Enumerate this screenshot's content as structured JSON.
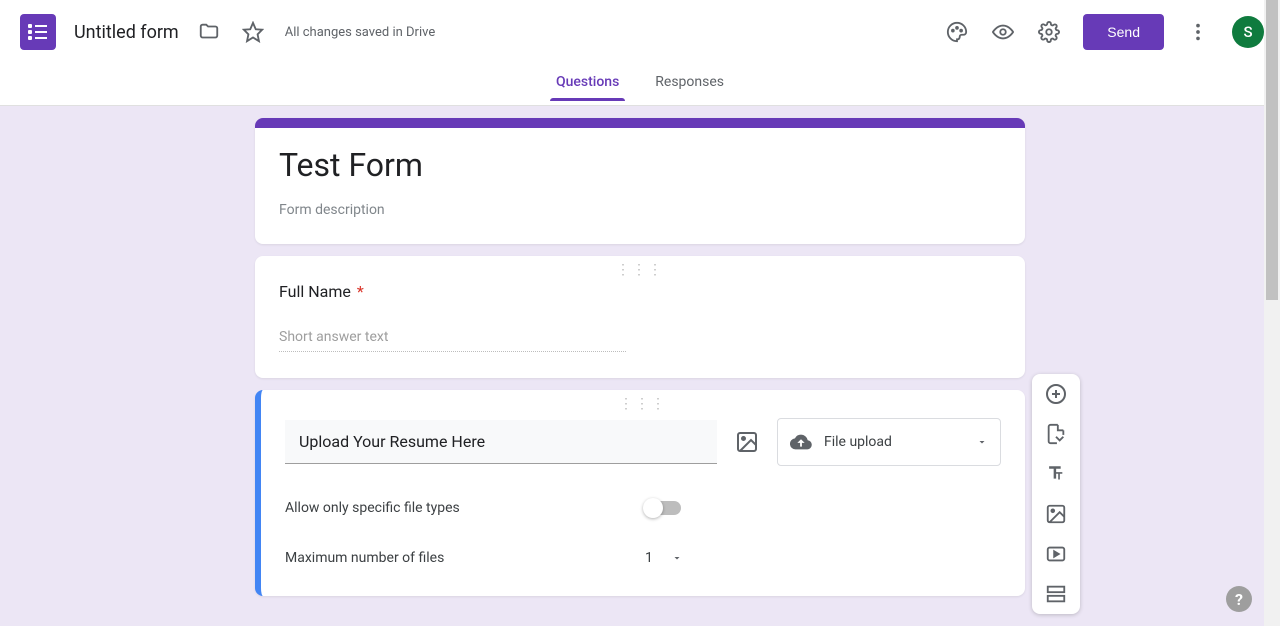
{
  "header": {
    "doc_title": "Untitled form",
    "save_status": "All changes saved in Drive",
    "send_label": "Send",
    "avatar_initial": "S"
  },
  "tabs": {
    "questions": "Questions",
    "responses": "Responses"
  },
  "form": {
    "title": "Test Form",
    "description_placeholder": "Form description"
  },
  "q1": {
    "label": "Full Name",
    "required_star": "*",
    "placeholder": "Short answer text"
  },
  "q2": {
    "title_value": "Upload Your Resume Here",
    "type_label": "File upload",
    "opt_specific_types": "Allow only specific file types",
    "opt_max_files": "Maximum number of files",
    "max_files_value": "1"
  },
  "help": "?"
}
